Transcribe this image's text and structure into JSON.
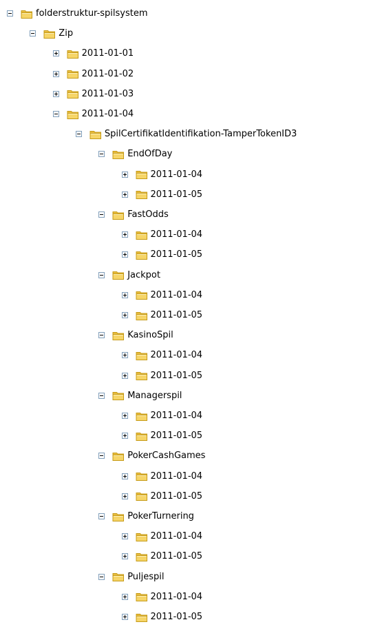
{
  "tree": {
    "nodes": [
      {
        "label": "folderstruktur-spilsystem",
        "depth": 0,
        "expanded": true
      },
      {
        "label": "Zip",
        "depth": 1,
        "expanded": true
      },
      {
        "label": "2011-01-01",
        "depth": 2,
        "expanded": false
      },
      {
        "label": "2011-01-02",
        "depth": 2,
        "expanded": false
      },
      {
        "label": "2011-01-03",
        "depth": 2,
        "expanded": false
      },
      {
        "label": "2011-01-04",
        "depth": 2,
        "expanded": true
      },
      {
        "label": "SpilCertifikatIdentifikation-TamperTokenID3",
        "depth": 3,
        "expanded": true
      },
      {
        "label": "EndOfDay",
        "depth": 4,
        "expanded": true
      },
      {
        "label": "2011-01-04",
        "depth": 5,
        "expanded": false
      },
      {
        "label": "2011-01-05",
        "depth": 5,
        "expanded": false
      },
      {
        "label": "FastOdds",
        "depth": 4,
        "expanded": true
      },
      {
        "label": "2011-01-04",
        "depth": 5,
        "expanded": false
      },
      {
        "label": "2011-01-05",
        "depth": 5,
        "expanded": false
      },
      {
        "label": "Jackpot",
        "depth": 4,
        "expanded": true
      },
      {
        "label": "2011-01-04",
        "depth": 5,
        "expanded": false
      },
      {
        "label": "2011-01-05",
        "depth": 5,
        "expanded": false
      },
      {
        "label": "KasinoSpil",
        "depth": 4,
        "expanded": true
      },
      {
        "label": "2011-01-04",
        "depth": 5,
        "expanded": false
      },
      {
        "label": "2011-01-05",
        "depth": 5,
        "expanded": false
      },
      {
        "label": "Managerspil",
        "depth": 4,
        "expanded": true
      },
      {
        "label": "2011-01-04",
        "depth": 5,
        "expanded": false
      },
      {
        "label": "2011-01-05",
        "depth": 5,
        "expanded": false
      },
      {
        "label": "PokerCashGames",
        "depth": 4,
        "expanded": true
      },
      {
        "label": "2011-01-04",
        "depth": 5,
        "expanded": false
      },
      {
        "label": "2011-01-05",
        "depth": 5,
        "expanded": false
      },
      {
        "label": "PokerTurnering",
        "depth": 4,
        "expanded": true
      },
      {
        "label": "2011-01-04",
        "depth": 5,
        "expanded": false
      },
      {
        "label": "2011-01-05",
        "depth": 5,
        "expanded": false
      },
      {
        "label": "Puljespil",
        "depth": 4,
        "expanded": true
      },
      {
        "label": "2011-01-04",
        "depth": 5,
        "expanded": false
      },
      {
        "label": "2011-01-05",
        "depth": 5,
        "expanded": false
      }
    ]
  },
  "icons": {
    "folder": "folder-icon",
    "expand": "plus-box-icon",
    "collapse": "minus-box-icon"
  },
  "colors": {
    "folder_fill": "#f6d568",
    "folder_stroke": "#c59a17",
    "toggle_border": "#7f9db9"
  }
}
